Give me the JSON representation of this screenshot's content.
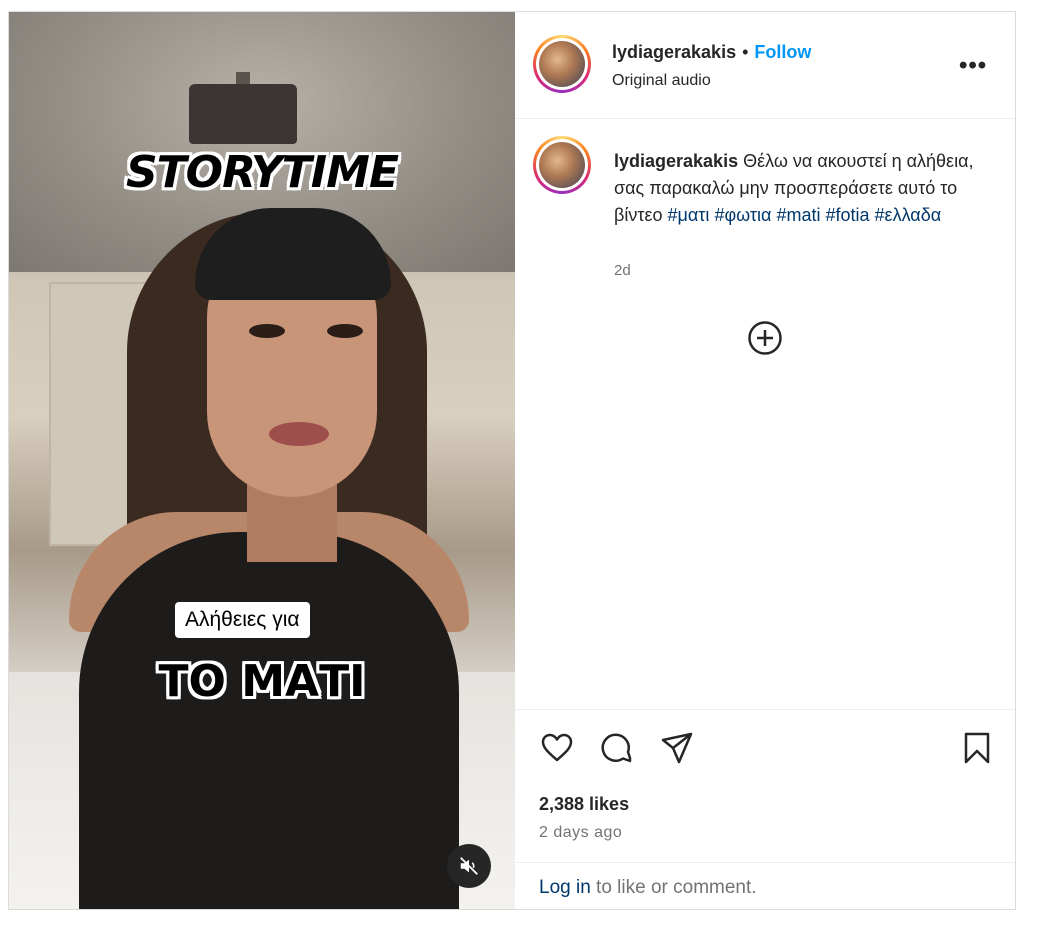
{
  "media": {
    "overlay_title": "STORYTIME",
    "caption_box": "Αλήθειες για",
    "overlay_big": "ΤΟ ΜΑΤΙ",
    "mute_icon": "speaker-muted-icon"
  },
  "header": {
    "username": "lydiagerakakis",
    "separator": "•",
    "follow_label": "Follow",
    "subtitle": "Original audio",
    "more_label": "•••"
  },
  "caption": {
    "username": "lydiagerakakis",
    "text": "Θέλω να ακουστεί η αλήθεια, σας παρακαλώ μην προσπεράσετε αυτό το βίντεο",
    "hashtags": [
      "#ματι",
      "#φωτια",
      "#mati",
      "#fotia",
      "#ελλαδα"
    ],
    "time": "2d"
  },
  "actions": {
    "icons": [
      "heart-icon",
      "comment-icon",
      "share-icon",
      "bookmark-icon"
    ],
    "likes": "2,388 likes",
    "posted": "2 days ago"
  },
  "login": {
    "link": "Log in",
    "rest": " to like or comment."
  },
  "colors": {
    "follow_blue": "#0095f6",
    "hashtag_blue": "#00376b",
    "muted_gray": "#737373"
  }
}
